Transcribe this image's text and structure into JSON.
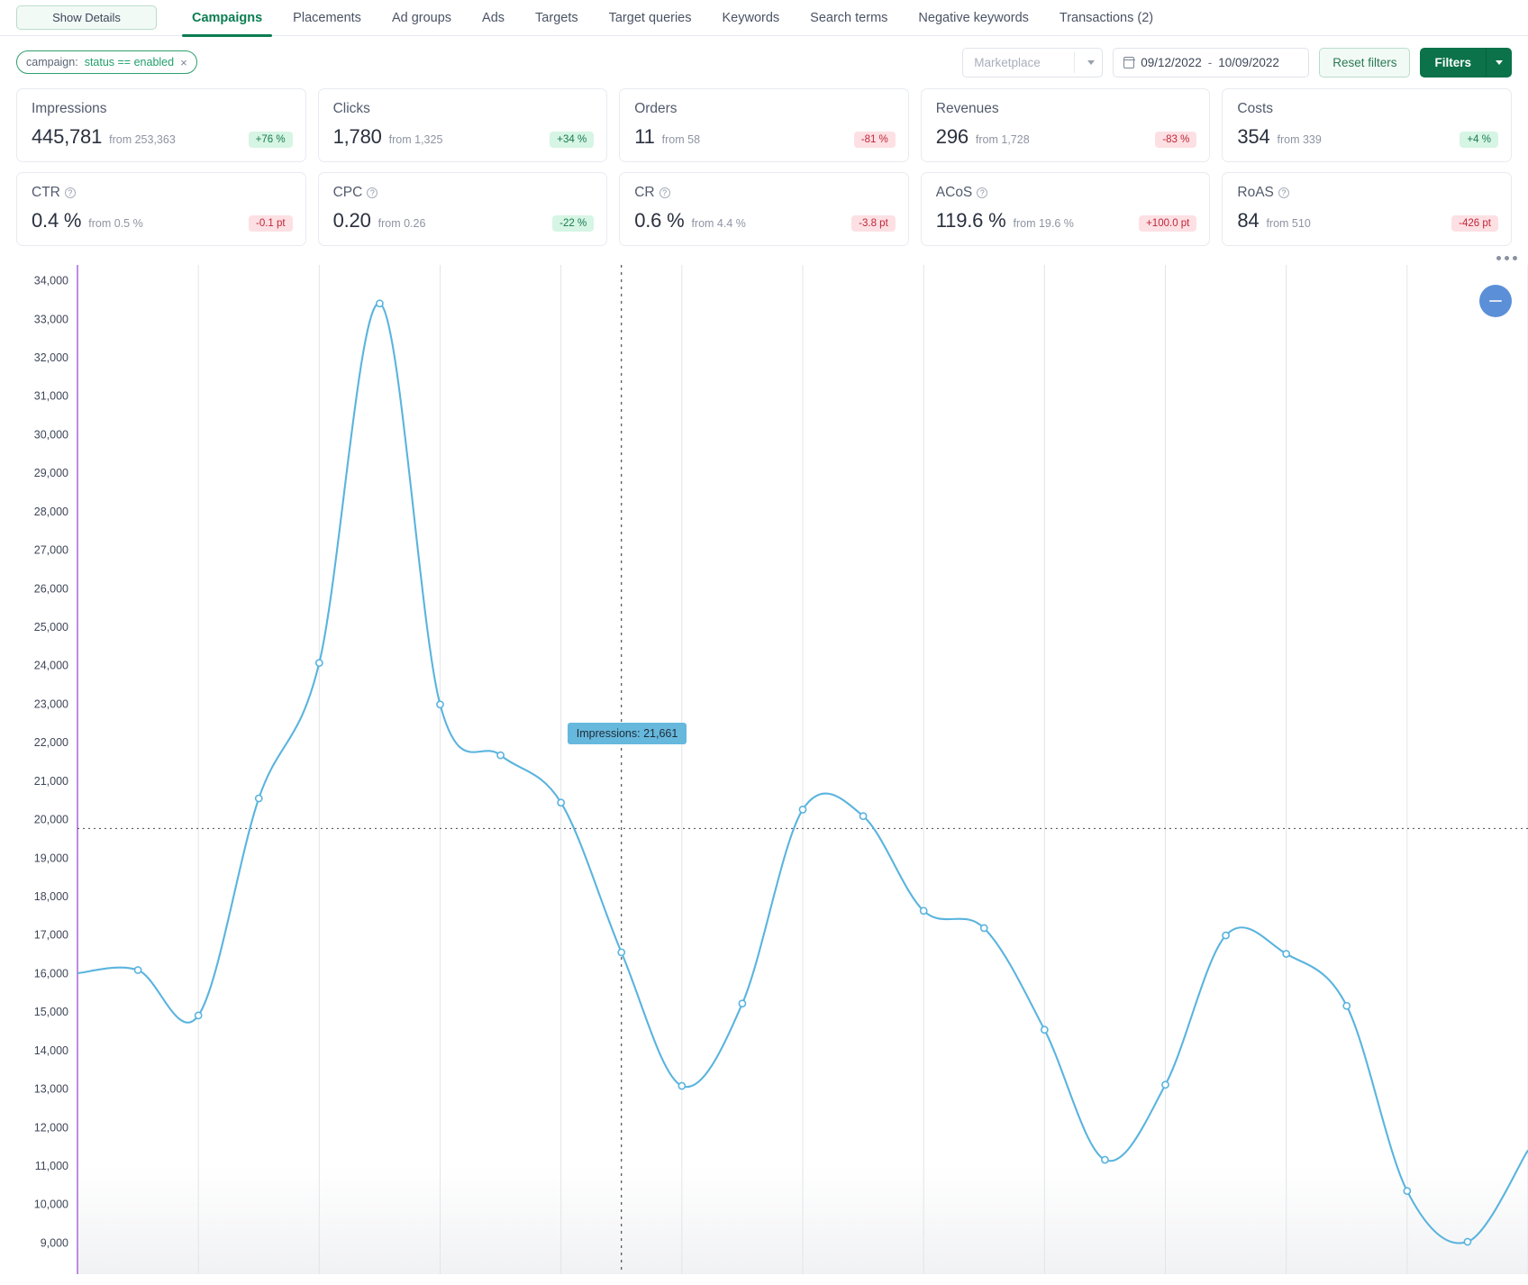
{
  "header": {
    "show_details_label": "Show Details",
    "tabs": [
      {
        "label": "Campaigns",
        "active": true
      },
      {
        "label": "Placements",
        "active": false
      },
      {
        "label": "Ad groups",
        "active": false
      },
      {
        "label": "Ads",
        "active": false
      },
      {
        "label": "Targets",
        "active": false
      },
      {
        "label": "Target queries",
        "active": false
      },
      {
        "label": "Keywords",
        "active": false
      },
      {
        "label": "Search terms",
        "active": false
      },
      {
        "label": "Negative keywords",
        "active": false
      },
      {
        "label": "Transactions (2)",
        "active": false
      }
    ]
  },
  "filters": {
    "chip": {
      "key": "campaign:",
      "value": "status == enabled",
      "close": "×"
    },
    "marketplace_placeholder": "Marketplace",
    "date_start": "09/12/2022",
    "date_separator": "-",
    "date_end": "10/09/2022",
    "reset_label": "Reset filters",
    "filters_label": "Filters"
  },
  "kpis": {
    "row1": [
      {
        "title": "Impressions",
        "value": "445,781",
        "from": "from 253,363",
        "delta": "+76 %",
        "direction": "up"
      },
      {
        "title": "Clicks",
        "value": "1,780",
        "from": "from 1,325",
        "delta": "+34 %",
        "direction": "up"
      },
      {
        "title": "Orders",
        "value": "11",
        "from": "from 58",
        "delta": "-81 %",
        "direction": "down"
      },
      {
        "title": "Revenues",
        "value": "296",
        "from": "from 1,728",
        "delta": "-83 %",
        "direction": "down"
      },
      {
        "title": "Costs",
        "value": "354",
        "from": "from 339",
        "delta": "+4 %",
        "direction": "up"
      }
    ],
    "row2": [
      {
        "title": "CTR",
        "info": "?",
        "value": "0.4 %",
        "from": "from 0.5 %",
        "delta": "-0.1 pt",
        "direction": "down"
      },
      {
        "title": "CPC",
        "info": "?",
        "value": "0.20",
        "from": "from 0.26",
        "delta": "-22 %",
        "direction": "up"
      },
      {
        "title": "CR",
        "info": "?",
        "value": "0.6 %",
        "from": "from 4.4 %",
        "delta": "-3.8 pt",
        "direction": "down"
      },
      {
        "title": "ACoS",
        "info": "?",
        "value": "119.6 %",
        "from": "from 19.6 %",
        "delta": "+100.0 pt",
        "direction": "down"
      },
      {
        "title": "RoAS",
        "info": "?",
        "value": "84",
        "from": "from 510",
        "delta": "-426 pt",
        "direction": "down"
      }
    ]
  },
  "chart_panel": {
    "menu_icon": "ellipsis-icon",
    "collapse_icon": "minus-icon",
    "tooltip": "Impressions: 21,661"
  },
  "chart_data": {
    "type": "line",
    "title": "",
    "xlabel": "",
    "ylabel": "",
    "series_name": "Impressions",
    "line_color": "#5ab4de",
    "axis_color": "#b77fe0",
    "ylim": [
      8600,
      34400
    ],
    "yticks": [
      34000,
      33000,
      32000,
      31000,
      30000,
      29000,
      28000,
      27000,
      26000,
      25000,
      24000,
      23000,
      22000,
      21000,
      20000,
      19000,
      18000,
      17000,
      16000,
      15000,
      14000,
      13000,
      12000,
      11000,
      10000,
      9000
    ],
    "ytick_labels": [
      "34,000",
      "33,000",
      "32,000",
      "31,000",
      "30,000",
      "29,000",
      "28,000",
      "27,000",
      "26,000",
      "25,000",
      "24,000",
      "23,000",
      "22,000",
      "21,000",
      "20,000",
      "19,000",
      "18,000",
      "17,000",
      "16,000",
      "15,000",
      "14,000",
      "13,000",
      "12,000",
      "11,000",
      "10,000",
      "9,000"
    ],
    "grid": {
      "vertical": true,
      "horizontal": false
    },
    "average_line": {
      "value": 19760,
      "style": "dotted"
    },
    "cursor_line": {
      "x_index": 9,
      "style": "dotted"
    },
    "highlight_point": {
      "index": 9,
      "value": 21661,
      "label": "Impressions: 21,661"
    },
    "values": [
      16000,
      16080,
      14900,
      20540,
      24060,
      33400,
      22980,
      21661,
      20430,
      16540,
      13070,
      15210,
      20250,
      20080,
      17620,
      17170,
      14530,
      11150,
      13100,
      16980,
      16500,
      15150,
      10340,
      9020,
      11400
    ],
    "marker_points": [
      {
        "index": 1,
        "value": 16080
      },
      {
        "index": 2,
        "value": 14900
      },
      {
        "index": 3,
        "value": 20540
      },
      {
        "index": 4,
        "value": 24060
      },
      {
        "index": 5,
        "value": 33400
      },
      {
        "index": 6,
        "value": 22980
      },
      {
        "index": 7,
        "value": 21661
      },
      {
        "index": 8,
        "value": 20430
      },
      {
        "index": 9,
        "value": 16540
      },
      {
        "index": 10,
        "value": 13070
      },
      {
        "index": 11,
        "value": 15210
      },
      {
        "index": 12,
        "value": 20250
      },
      {
        "index": 13,
        "value": 20080
      },
      {
        "index": 14,
        "value": 17620
      },
      {
        "index": 15,
        "value": 17170
      },
      {
        "index": 16,
        "value": 14530
      },
      {
        "index": 17,
        "value": 11150
      },
      {
        "index": 18,
        "value": 13100
      },
      {
        "index": 19,
        "value": 16980
      },
      {
        "index": 20,
        "value": 16500
      },
      {
        "index": 21,
        "value": 15150
      },
      {
        "index": 22,
        "value": 10340
      },
      {
        "index": 23,
        "value": 9020
      }
    ]
  },
  "colors": {
    "brand_green": "#0b7249",
    "line_blue": "#5ab4de",
    "axis_purple": "#b77fe0",
    "badge_up_bg": "#d6f5e4",
    "badge_down_bg": "#fde0e3"
  }
}
